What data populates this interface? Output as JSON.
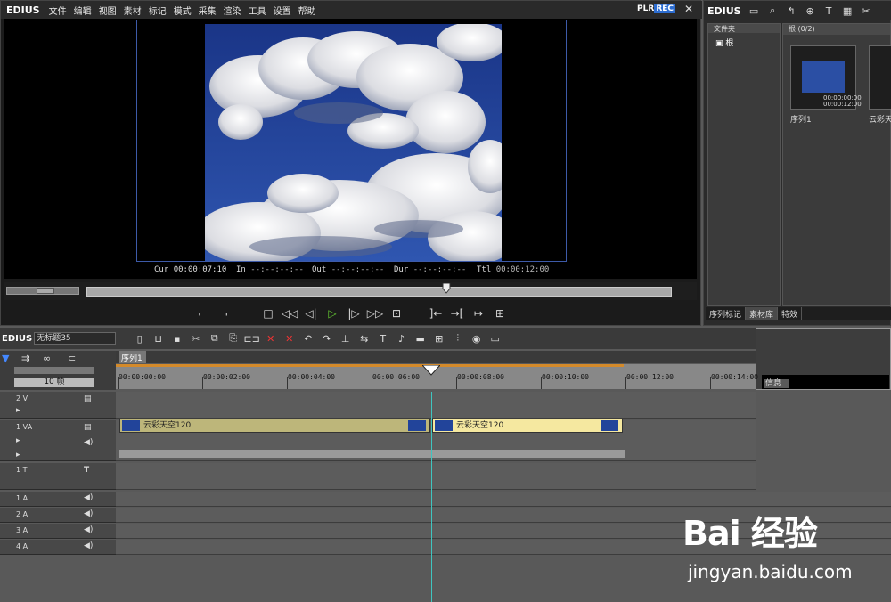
{
  "player": {
    "logo": "EDIUS",
    "menus": [
      "文件",
      "编辑",
      "视图",
      "素材",
      "标记",
      "模式",
      "采集",
      "渲染",
      "工具",
      "设置",
      "帮助"
    ],
    "plr": "PLR",
    "rec": "REC",
    "timecode": {
      "cur_label": "Cur",
      "cur": "00:00:07:10",
      "in_label": "In",
      "in": "--:--:--:--",
      "out_label": "Out",
      "out": "--:--:--:--",
      "dur_label": "Dur",
      "dur": "--:--:--:--",
      "ttl_label": "Ttl",
      "ttl": "00:00:12:00"
    },
    "progress": 0.62
  },
  "bin": {
    "logo": "EDIUS",
    "folder_header": "文件夹",
    "root": "根",
    "clip_header": "根 (0/2)",
    "clips": [
      {
        "name": "序列1",
        "tc1": "00:00:00:00",
        "tc2": "00:00:12:00"
      },
      {
        "name": "云彩天"
      }
    ],
    "tabs": [
      "序列标记",
      "素材库",
      "特效"
    ]
  },
  "timeline": {
    "logo": "EDIUS",
    "project": "无标题35",
    "seq_tab": "序列1",
    "zoom": "10 帧",
    "ruler": [
      "00:00:00:00",
      "00:00:02:00",
      "00:00:04:00",
      "00:00:06:00",
      "00:00:08:00",
      "00:00:10:00",
      "00:00:12:00",
      "00:00:14:00"
    ],
    "info": "信息",
    "tracks": {
      "v2": "2 V",
      "va1": "1 VA",
      "t1": "1 T",
      "a1": "1 A",
      "a2": "2 A",
      "a3": "3 A",
      "a4": "4 A"
    },
    "clips": [
      {
        "name": "云彩天空120"
      },
      {
        "name": "云彩天空120"
      }
    ]
  },
  "watermark": {
    "brand": "Bai 经验",
    "url": "jingyan.baidu.com"
  },
  "colors": {
    "accent": "#2d6dd0",
    "clip_a": "#bdb67a",
    "clip_b": "#f5e8a0",
    "playline": "#3fc5c0"
  }
}
